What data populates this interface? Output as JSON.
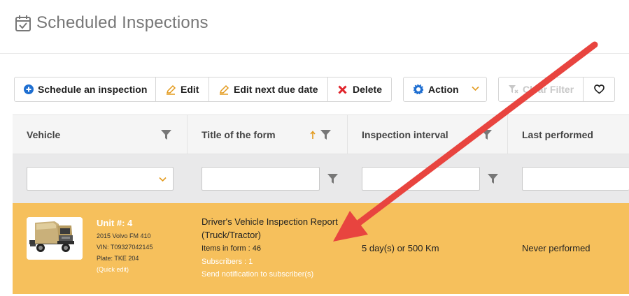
{
  "page": {
    "title": "Scheduled Inspections"
  },
  "toolbar": {
    "schedule_label": "Schedule an inspection",
    "edit_label": "Edit",
    "edit_due_label": "Edit next due date",
    "delete_label": "Delete",
    "action_label": "Action",
    "clear_filter_label": "Clear Filter"
  },
  "columns": {
    "vehicle": "Vehicle",
    "form_title": "Title of the form",
    "interval": "Inspection interval",
    "last_performed": "Last performed"
  },
  "row": {
    "unit": "Unit #: 4",
    "model": "2015 Volvo FM 410",
    "vin": "VIN: T09327042145",
    "plate": "Plate: TKE 204",
    "quick_edit": "(Quick edit)",
    "form_title": "Driver's Vehicle Inspection Report (Truck/Tractor)",
    "items": "Items in form : 46",
    "subscribers": "Subscribers : 1",
    "notify": "Send notification to subscriber(s)",
    "interval": "5 day(s) or 500 Km",
    "last_performed": "Never performed"
  },
  "colors": {
    "row_highlight": "#f6c05c",
    "primary_blue": "#1f6fd1",
    "delete_red": "#e0242b",
    "pencil_orange": "#e39a1d",
    "arrow_red": "#e8443f"
  },
  "icons": {
    "page": "calendar-check-icon",
    "schedule": "plus-circle-icon",
    "edit": "pencil-icon",
    "delete": "x-icon",
    "action": "gear-icon",
    "clear_filter": "filter-clear-icon",
    "favorite": "heart-icon",
    "sort": "arrow-up-icon",
    "filter": "funnel-icon"
  }
}
